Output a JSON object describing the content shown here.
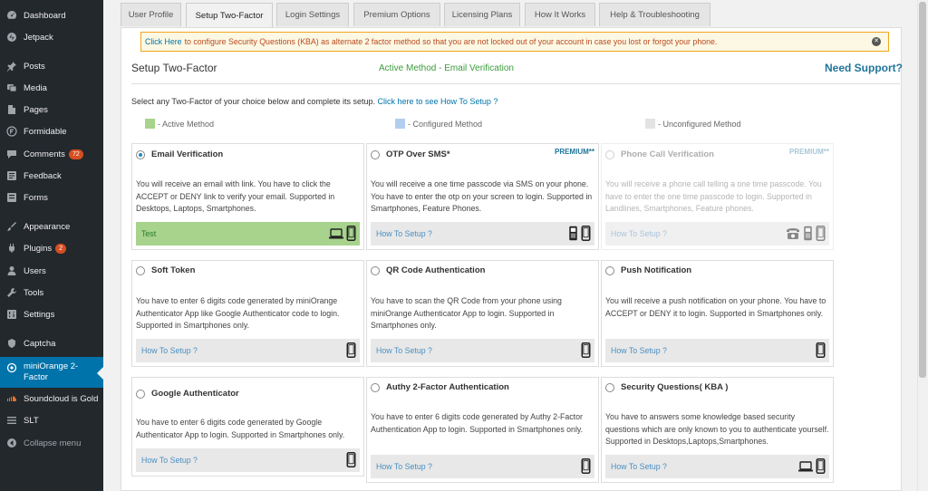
{
  "sidebar": {
    "items": [
      {
        "label": "Dashboard",
        "icon": "dashboard-icon"
      },
      {
        "label": "Jetpack",
        "icon": "jetpack-icon"
      },
      {
        "label": "Posts",
        "icon": "pin-icon"
      },
      {
        "label": "Media",
        "icon": "media-icon"
      },
      {
        "label": "Pages",
        "icon": "page-icon"
      },
      {
        "label": "Formidable",
        "icon": "formidable-icon"
      },
      {
        "label": "Comments",
        "icon": "comment-icon",
        "badge": "72"
      },
      {
        "label": "Feedback",
        "icon": "feedback-icon"
      },
      {
        "label": "Forms",
        "icon": "forms-icon"
      },
      {
        "label": "Appearance",
        "icon": "brush-icon"
      },
      {
        "label": "Plugins",
        "icon": "plugin-icon",
        "badge": "2"
      },
      {
        "label": "Users",
        "icon": "user-icon"
      },
      {
        "label": "Tools",
        "icon": "wrench-icon"
      },
      {
        "label": "Settings",
        "icon": "settings-icon"
      },
      {
        "label": "Captcha",
        "icon": "captcha-icon"
      },
      {
        "label": "miniOrange 2-Factor",
        "icon": "miniorange-icon"
      },
      {
        "label": "Soundcloud is Gold",
        "icon": "soundcloud-icon"
      },
      {
        "label": "SLT",
        "icon": "slt-icon"
      },
      {
        "label": "Collapse menu",
        "icon": "collapse-icon"
      }
    ]
  },
  "tabs": [
    "User Profile",
    "Setup Two-Factor",
    "Login Settings",
    "Premium Options",
    "Licensing Plans",
    "How It Works",
    "Help & Troubleshooting"
  ],
  "notice": {
    "link": "Click Here",
    "text": "to configure Security Questions (KBA) as alternate 2 factor method so that you are not locked out of your account in case you lost or forgot your phone."
  },
  "header": {
    "title": "Setup Two-Factor",
    "active_method": "Active Method - Email Verification",
    "support": "Need Support?"
  },
  "intro": {
    "text": "Select any Two-Factor of your choice below and complete its setup.",
    "link": "Click here to see How To Setup ?"
  },
  "legend": [
    {
      "label": "- Active Method",
      "color": "#a7d38d"
    },
    {
      "label": "- Configured Method",
      "color": "#b3cdee"
    },
    {
      "label": "- Unconfigured Method",
      "color": "#e3e3e3"
    }
  ],
  "methods": [
    {
      "title": "Email Verification",
      "premium": "",
      "desc": "You will receive an email with link. You have to click the ACCEPT or DENY link to verify your email. Supported in Desktops, Laptops, Smartphones.",
      "footer": "Test",
      "devices": [
        "laptop-icon",
        "smartphone-icon"
      ]
    },
    {
      "title": "OTP Over SMS*",
      "premium": "PREMIUM**",
      "desc": "You will receive a one time passcode via SMS on your phone. You have to enter the otp on your screen to login. Supported in Smartphones, Feature Phones.",
      "footer": "How To Setup ?",
      "devices": [
        "feature-phone-icon",
        "smartphone-icon"
      ]
    },
    {
      "title": "Phone Call Verification",
      "premium": "PREMIUM**",
      "desc": "You will receive a phone call telling a one time passcode. You have to enter the one time passcode to login. Supported in Landlines, Smartphones, Feature phones.",
      "footer": "How To Setup ?",
      "devices": [
        "landline-icon",
        "feature-phone-icon",
        "smartphone-icon"
      ]
    },
    {
      "title": "Soft Token",
      "premium": "",
      "desc": "You have to enter 6 digits code generated by miniOrange Authenticator App like Google Authenticator code to login. Supported in Smartphones only.",
      "footer": "How To Setup ?",
      "devices": [
        "smartphone-icon"
      ]
    },
    {
      "title": "QR Code Authentication",
      "premium": "",
      "desc": "You have to scan the QR Code from your phone using miniOrange Authenticator App to login. Supported in Smartphones only.",
      "footer": "How To Setup ?",
      "devices": [
        "smartphone-icon"
      ]
    },
    {
      "title": "Push Notification",
      "premium": "",
      "desc": "You will receive a push notification on your phone. You have to ACCEPT or DENY it to login. Supported in Smartphones only.",
      "footer": "How To Setup ?",
      "devices": [
        "smartphone-icon"
      ]
    },
    {
      "title": "Google Authenticator",
      "premium": "",
      "desc": "You have to enter 6 digits code generated by Google Authenticator App to login. Supported in Smartphones only.",
      "footer": "How To Setup ?",
      "devices": [
        "smartphone-icon"
      ]
    },
    {
      "title": "Authy 2-Factor Authentication",
      "premium": "",
      "desc": "You have to enter 6 digits code generated by Authy 2-Factor Authentication App to login. Supported in Smartphones only.",
      "footer": "How To Setup ?",
      "devices": [
        "smartphone-icon"
      ]
    },
    {
      "title": "Security Questions( KBA )",
      "premium": "",
      "desc": "You have to answers some knowledge based security questions which are only known to you to authenticate yourself. Supported in Desktops,Laptops,Smartphones.",
      "footer": "How To Setup ?",
      "devices": [
        "laptop-icon",
        "smartphone-icon"
      ]
    }
  ]
}
